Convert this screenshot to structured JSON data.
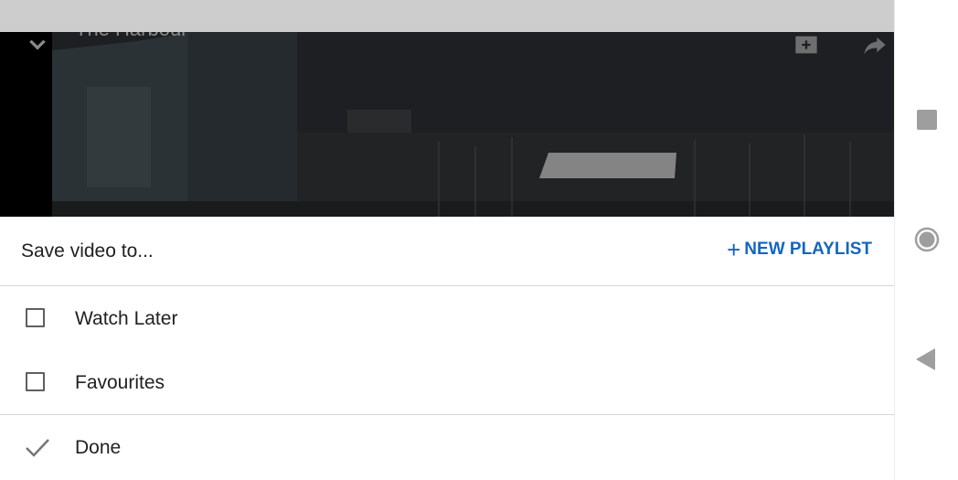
{
  "video": {
    "title": "The Harbour",
    "icons": [
      "chevron-down-icon",
      "add-to-queue-icon",
      "share-icon"
    ]
  },
  "sheet": {
    "title": "Save video to...",
    "new_playlist_plus": "+",
    "new_playlist_label": "NEW PLAYLIST",
    "playlists": [
      {
        "label": "Watch Later",
        "checked": false
      },
      {
        "label": "Favourites",
        "checked": false
      }
    ],
    "done_label": "Done"
  },
  "nav": {
    "icons": [
      "recents-square-icon",
      "home-circle-icon",
      "back-triangle-icon"
    ]
  },
  "colors": {
    "accent": "#1565c0",
    "status_bar": "#cdcdcd",
    "text": "#212121"
  }
}
